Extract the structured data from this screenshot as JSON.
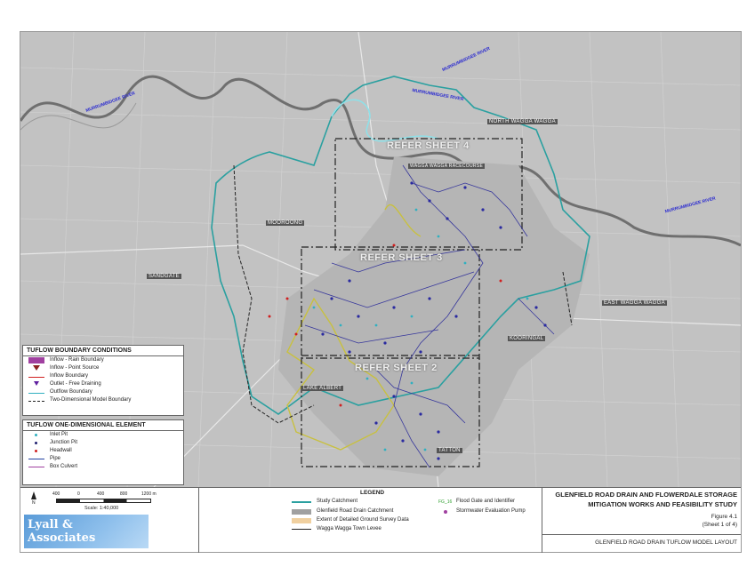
{
  "map": {
    "refer_sheets": [
      "REFER SHEET 4",
      "REFER SHEET 3",
      "REFER SHEET 2"
    ],
    "place_labels": [
      "NORTH WAGGA WAGGA",
      "MOOROONG",
      "SANDGATE",
      "EAST WAGGA WAGGA",
      "KOORINGAL",
      "LAKE ALBERT",
      "TATTON",
      "WAGGA WAGGA RACECOURSE"
    ],
    "river_labels": [
      "MURRUMBIDGEE RIVER",
      "MURRUMBIDGEE RIVER",
      "MURRUMBIDGEE RIVER",
      "MURRUMBIDGEE RIVER"
    ]
  },
  "boundary_conditions": {
    "title": "TUFLOW BOUNDARY CONDITIONS",
    "items": [
      {
        "label": "Inflow - Rain Boundary",
        "color": "#a040a0"
      },
      {
        "label": "Inflow - Point Source",
        "color": "#8b2020"
      },
      {
        "label": "Inflow Boundary",
        "color": "#d02020"
      },
      {
        "label": "Outlet - Free Draining",
        "color": "#6020a0"
      },
      {
        "label": "Outflow Boundary",
        "color": "#30b0c0"
      },
      {
        "label": "Two-Dimensional Model Boundary",
        "color": "#222222"
      }
    ]
  },
  "one_dimensional": {
    "title": "TUFLOW ONE-DIMENSIONAL ELEMENT",
    "items": [
      {
        "label": "Inlet Pit",
        "color": "#30b0c0"
      },
      {
        "label": "Junction Pit",
        "color": "#202070"
      },
      {
        "label": "Headwall",
        "color": "#d02020"
      },
      {
        "label": "Pipe",
        "color": "#2040a0"
      },
      {
        "label": "Box Culvert",
        "color": "#a040a0"
      }
    ]
  },
  "scale": {
    "north": "N",
    "ticks": [
      "400",
      "0",
      "400",
      "800",
      "1200 m"
    ],
    "label": "Scale: 1:40,000"
  },
  "logo": {
    "line1": "Lyall &",
    "line2": "Associates"
  },
  "legend": {
    "title": "LEGEND",
    "left_items": [
      {
        "label": "Study Catchment",
        "color": "#2aa0a0"
      },
      {
        "label": "Glenfield Road Drain Catchment",
        "color": "#a0a0a0"
      },
      {
        "label": "Extent of Detailed Ground Survey Data",
        "color": "#f0d0a0"
      },
      {
        "label": "Wagga Wagga Town Levee",
        "color": "#222222"
      }
    ],
    "right_items": [
      {
        "symbol": "FG_16",
        "label": "Flood Gate and Identifier",
        "color": "#30a030"
      },
      {
        "symbol": "",
        "label": "Stormwater Evaluation Pump",
        "color": "#a040a0"
      }
    ]
  },
  "title_block": {
    "line1": "GLENFIELD ROAD DRAIN AND FLOWERDALE STORAGE",
    "line2": "MITIGATION WORKS AND FEASIBILITY STUDY",
    "figure": "Figure 4.1",
    "sheet": "(Sheet 1 of 4)",
    "subtitle": "GLENFIELD ROAD DRAIN TUFLOW MODEL LAYOUT"
  }
}
